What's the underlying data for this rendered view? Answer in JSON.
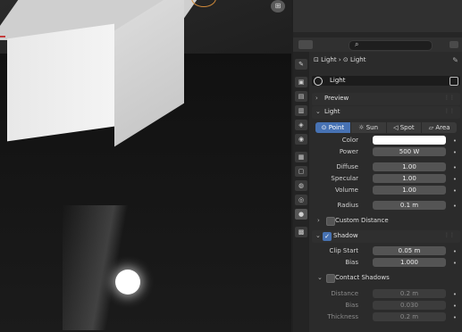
{
  "viewport": {
    "gizmo_icon": "grid-icon"
  },
  "header": {
    "editor_icon": "properties-editor-icon",
    "search_icon": "search-icon",
    "right_icon": "editor-options-icon"
  },
  "tabs": [
    {
      "name": "tool-tab",
      "glyph": "🔧"
    },
    {
      "name": "render-tab",
      "glyph": "▣"
    },
    {
      "name": "output-tab",
      "glyph": "▤"
    },
    {
      "name": "view-layer-tab",
      "glyph": "▥"
    },
    {
      "name": "scene-tab",
      "glyph": "◈"
    },
    {
      "name": "world-tab",
      "glyph": "◉"
    },
    {
      "name": "collection-tab",
      "glyph": "▦"
    },
    {
      "name": "object-tab",
      "glyph": "▢"
    },
    {
      "name": "modifiers-tab",
      "glyph": "◍"
    },
    {
      "name": "physics-tab",
      "glyph": "◎"
    },
    {
      "name": "object-data-tab",
      "glyph": "●"
    },
    {
      "name": "texture-tab",
      "glyph": "▩"
    }
  ],
  "breadcrumb": {
    "obj": "Light",
    "sep": "›",
    "data": "Light"
  },
  "datablock": {
    "name": "Light"
  },
  "sections": {
    "preview": "Preview",
    "light": "Light"
  },
  "light_types": [
    "Point",
    "Sun",
    "Spot",
    "Area"
  ],
  "light_props": {
    "color_label": "Color",
    "power_label": "Power",
    "power_value": "500 W",
    "diffuse_label": "Diffuse",
    "diffuse_value": "1.00",
    "specular_label": "Specular",
    "specular_value": "1.00",
    "volume_label": "Volume",
    "volume_value": "1.00",
    "radius_label": "Radius",
    "radius_value": "0.1 m",
    "color_hex": "#ffffff"
  },
  "custom_distance": "Custom Distance",
  "shadow": {
    "title": "Shadow",
    "clip_start_label": "Clip Start",
    "clip_start_value": "0.05 m",
    "bias_label": "Bias",
    "bias_value": "1.000"
  },
  "contact_shadows": {
    "title": "Contact Shadows",
    "distance_label": "Distance",
    "distance_value": "0.2 m",
    "bias_label": "Bias",
    "bias_value": "0.030",
    "thickness_label": "Thickness",
    "thickness_value": "0.2 m"
  },
  "colors": {
    "accent": "#4772b3",
    "panel_bg": "#2b2b2b"
  }
}
